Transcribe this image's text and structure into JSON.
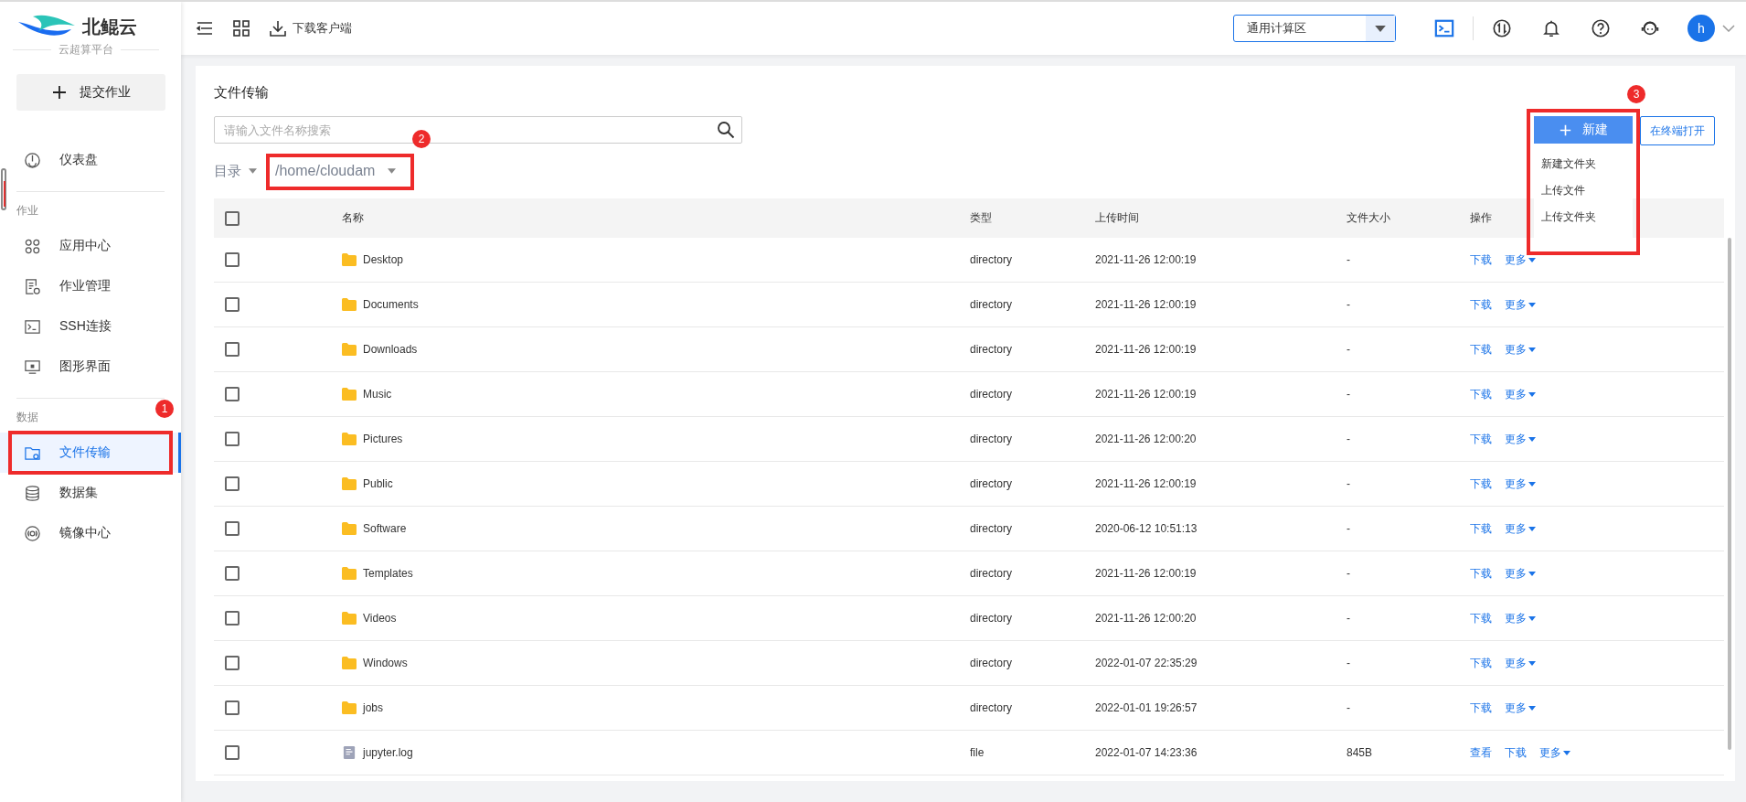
{
  "brand": {
    "name": "北鲲云",
    "subtitle": "云超算平台"
  },
  "sidebar": {
    "submit_button": "提交作业",
    "items": [
      {
        "kind": "item",
        "label": "仪表盘",
        "selected": false
      },
      {
        "kind": "section",
        "label": "作业"
      },
      {
        "kind": "item",
        "label": "应用中心",
        "selected": false
      },
      {
        "kind": "item",
        "label": "作业管理",
        "selected": false
      },
      {
        "kind": "item",
        "label": "SSH连接",
        "selected": false
      },
      {
        "kind": "item",
        "label": "图形界面",
        "selected": false
      },
      {
        "kind": "section",
        "label": "数据"
      },
      {
        "kind": "item",
        "label": "文件传输",
        "selected": true,
        "annotation": "1"
      },
      {
        "kind": "item",
        "label": "数据集",
        "selected": false
      },
      {
        "kind": "item",
        "label": "镜像中心",
        "selected": false
      }
    ]
  },
  "topbar": {
    "download_client": "下载客户端",
    "zone_select": "通用计算区",
    "avatar": "h"
  },
  "page": {
    "title": "文件传输",
    "search": {
      "placeholder": "请输入文件名称搜索"
    },
    "directory_label": "目录",
    "path": "/home/cloudam",
    "path_annotation": "2",
    "new_button": "新建",
    "new_annotation": "3",
    "new_menu": [
      "新建文件夹",
      "上传文件",
      "上传文件夹"
    ],
    "terminal_button": "在终端打开"
  },
  "table": {
    "select_all": {
      "checked": false
    },
    "columns": [
      "名称",
      "类型",
      "上传时间",
      "文件大小",
      "操作"
    ],
    "rows": [
      {
        "checked": false,
        "kind": "folder",
        "name": "Desktop",
        "type": "directory",
        "time": "2021-11-26 12:00:19",
        "size": "-",
        "actions": [
          "下载",
          "更多"
        ]
      },
      {
        "checked": false,
        "kind": "folder",
        "name": "Documents",
        "type": "directory",
        "time": "2021-11-26 12:00:19",
        "size": "-",
        "actions": [
          "下载",
          "更多"
        ]
      },
      {
        "checked": false,
        "kind": "folder",
        "name": "Downloads",
        "type": "directory",
        "time": "2021-11-26 12:00:19",
        "size": "-",
        "actions": [
          "下载",
          "更多"
        ]
      },
      {
        "checked": false,
        "kind": "folder",
        "name": "Music",
        "type": "directory",
        "time": "2021-11-26 12:00:19",
        "size": "-",
        "actions": [
          "下载",
          "更多"
        ]
      },
      {
        "checked": false,
        "kind": "folder",
        "name": "Pictures",
        "type": "directory",
        "time": "2021-11-26 12:00:20",
        "size": "-",
        "actions": [
          "下载",
          "更多"
        ]
      },
      {
        "checked": false,
        "kind": "folder",
        "name": "Public",
        "type": "directory",
        "time": "2021-11-26 12:00:19",
        "size": "-",
        "actions": [
          "下载",
          "更多"
        ]
      },
      {
        "checked": false,
        "kind": "folder",
        "name": "Software",
        "type": "directory",
        "time": "2020-06-12 10:51:13",
        "size": "-",
        "actions": [
          "下载",
          "更多"
        ]
      },
      {
        "checked": false,
        "kind": "folder",
        "name": "Templates",
        "type": "directory",
        "time": "2021-11-26 12:00:19",
        "size": "-",
        "actions": [
          "下载",
          "更多"
        ]
      },
      {
        "checked": false,
        "kind": "folder",
        "name": "Videos",
        "type": "directory",
        "time": "2021-11-26 12:00:20",
        "size": "-",
        "actions": [
          "下载",
          "更多"
        ]
      },
      {
        "checked": false,
        "kind": "folder",
        "name": "Windows",
        "type": "directory",
        "time": "2022-01-07 22:35:29",
        "size": "-",
        "actions": [
          "下载",
          "更多"
        ]
      },
      {
        "checked": false,
        "kind": "folder",
        "name": "jobs",
        "type": "directory",
        "time": "2022-01-01 19:26:57",
        "size": "-",
        "actions": [
          "下载",
          "更多"
        ]
      },
      {
        "checked": false,
        "kind": "file",
        "name": "jupyter.log",
        "type": "file",
        "time": "2022-01-07 14:23:36",
        "size": "845B",
        "actions": [
          "查看",
          "下载",
          "更多"
        ]
      }
    ]
  }
}
